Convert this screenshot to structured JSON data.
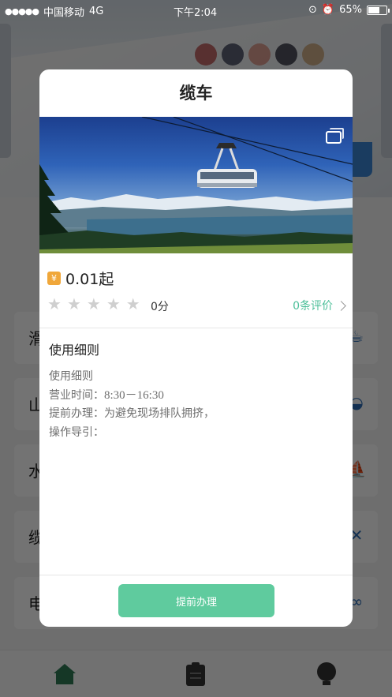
{
  "status_bar": {
    "carrier": "中国移动",
    "network": "4G",
    "time": "下午2:04",
    "battery": "65%",
    "battery_level": 0.65
  },
  "background": {
    "list": [
      {
        "label": "滑",
        "icon": "cup-icon"
      },
      {
        "label": "山",
        "icon": "bowl-icon"
      },
      {
        "label": "水",
        "icon": "boat-icon"
      },
      {
        "label": "缆",
        "icon": "figure-icon"
      },
      {
        "label": "电",
        "icon": "bike-icon"
      }
    ],
    "tabs": [
      {
        "name": "home-tab-icon",
        "color": "#2f7a55"
      },
      {
        "name": "orders-tab-icon",
        "color": "#333333"
      },
      {
        "name": "profile-tab-icon",
        "color": "#333333"
      }
    ]
  },
  "modal": {
    "title": "缆车",
    "price_badge": "¥",
    "price": "0.01起",
    "rating_stars": 5,
    "rating_value": 0,
    "score_text": "0分",
    "reviews_text": "0条评价",
    "rules_heading": "使用细则",
    "rules": {
      "subheading": "使用细则",
      "hours_label": "营业时间：",
      "hours_value": "8:30－16:30",
      "advance_label": "提前办理：",
      "advance_value": "为避免现场排队拥挤，",
      "guide_label": "操作导引："
    },
    "button_label": "提前办理"
  },
  "colors": {
    "accent_green": "#5fcb9e",
    "review_green": "#4cbf99",
    "badge_orange": "#f0a73a"
  }
}
